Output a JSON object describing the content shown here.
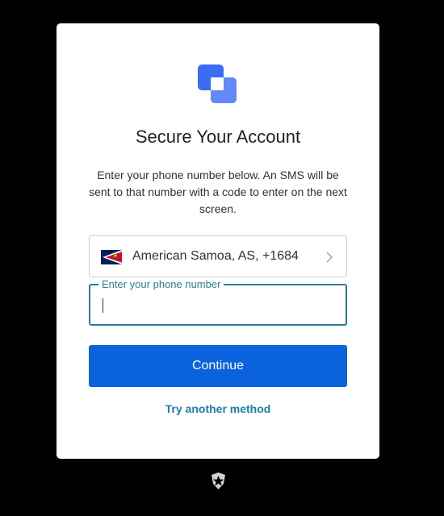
{
  "colors": {
    "page_background": "#000000",
    "card_background": "#ffffff",
    "accent": "#0a63dc",
    "focus": "#2e7d98",
    "link": "#1a7fa8",
    "logo_primary": "#3b6cf5"
  },
  "header": {
    "logo_icon": "stacked-squares-logo-icon",
    "title": "Secure Your Account",
    "description": "Enter your phone number below. An SMS will be sent to that number with a code to enter on the next screen."
  },
  "form": {
    "country": {
      "flag_icon": "american-samoa-flag-icon",
      "label": "American Samoa, AS, +1684",
      "chevron_icon": "chevron-right-icon"
    },
    "phone": {
      "label": "Enter your phone number",
      "value": ""
    },
    "continue_label": "Continue",
    "alternate_label": "Try another method"
  },
  "footer": {
    "brand_icon": "auth0-shield-icon"
  }
}
